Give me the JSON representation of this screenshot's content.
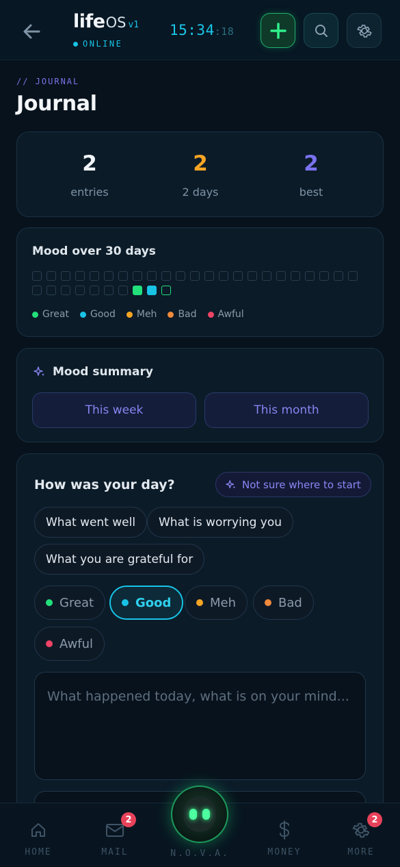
{
  "header": {
    "brand_life": "life",
    "brand_os": "OS",
    "brand_version": "v1",
    "status": "ONLINE",
    "clock_hm": "15:34",
    "clock_sec": ":18"
  },
  "page": {
    "eyebrow": "// JOURNAL",
    "title": "Journal"
  },
  "stats": [
    {
      "value": "2",
      "label": "entries",
      "color": "#f2f6fa"
    },
    {
      "value": "2",
      "label": "2 days",
      "color": "#f5a524"
    },
    {
      "value": "2",
      "label": "best",
      "color": "#7b72f0"
    }
  ],
  "mood_chart": {
    "title": "Mood over 30 days",
    "days": [
      "empty",
      "empty",
      "empty",
      "empty",
      "empty",
      "empty",
      "empty",
      "empty",
      "empty",
      "empty",
      "empty",
      "empty",
      "empty",
      "empty",
      "empty",
      "empty",
      "empty",
      "empty",
      "empty",
      "empty",
      "empty",
      "empty",
      "empty",
      "empty",
      "empty",
      "empty",
      "empty",
      "empty",
      "empty",
      "empty",
      "great",
      "good",
      "today"
    ],
    "legend": [
      {
        "label": "Great",
        "color": "#22e07a"
      },
      {
        "label": "Good",
        "color": "#19c3e6"
      },
      {
        "label": "Meh",
        "color": "#f5a524"
      },
      {
        "label": "Bad",
        "color": "#f08a3c"
      },
      {
        "label": "Awful",
        "color": "#ee4466"
      }
    ]
  },
  "summary": {
    "title": "Mood summary",
    "week_label": "This week",
    "month_label": "This month"
  },
  "entry": {
    "question": "How was your day?",
    "help_label": "Not sure where to start",
    "prompts": [
      "What went well",
      "What is worrying you",
      "What you are grateful for"
    ],
    "moods": [
      {
        "label": "Great",
        "color": "#22e07a"
      },
      {
        "label": "Good",
        "color": "#19c3e6",
        "active": true
      },
      {
        "label": "Meh",
        "color": "#f5a524"
      },
      {
        "label": "Bad",
        "color": "#f08a3c"
      },
      {
        "label": "Awful",
        "color": "#ee4466"
      }
    ],
    "placeholder": "What happened today, what is on your mind..."
  },
  "nav": {
    "home": "HOME",
    "mail": "MAIL",
    "mail_badge": "2",
    "nova": "N.O.V.A.",
    "money": "MONEY",
    "more": "MORE",
    "more_badge": "2"
  }
}
